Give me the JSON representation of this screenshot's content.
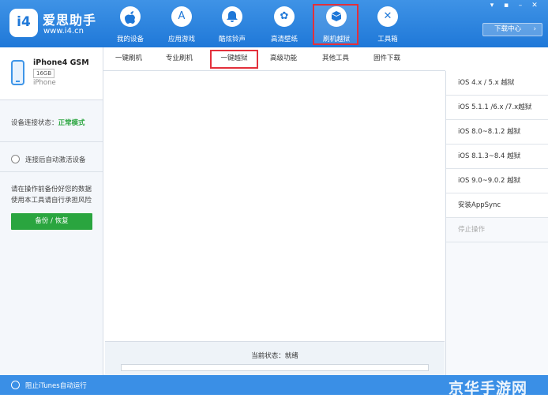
{
  "app": {
    "brand_name": "爱思助手",
    "brand_url": "www.i4.cn",
    "logo_glyph": "i4"
  },
  "nav": [
    {
      "label": "我的设备",
      "icon": "apple-icon",
      "glyph": ""
    },
    {
      "label": "应用游戏",
      "icon": "app-store-icon",
      "glyph": "A"
    },
    {
      "label": "酷炫铃声",
      "icon": "bell-icon",
      "glyph": "♪"
    },
    {
      "label": "高清壁纸",
      "icon": "flower-icon",
      "glyph": "✿"
    },
    {
      "label": "刷机越狱",
      "icon": "box-icon",
      "glyph": "❒",
      "active": true
    },
    {
      "label": "工具箱",
      "icon": "tools-icon",
      "glyph": "✕"
    }
  ],
  "window_controls": [
    "▾",
    "▪",
    "–",
    "✕"
  ],
  "download_center": "下载中心",
  "device": {
    "name": "iPhone4 GSM",
    "capacity": "16GB",
    "type": "iPhone"
  },
  "connection": {
    "label": "设备连接状态：",
    "mode": "正常模式"
  },
  "auto_activate_label": "连接后自动激活设备",
  "warning_lines": [
    "请在操作前备份好您的数据",
    "使用本工具请自行承担风险"
  ],
  "backup_button": "备份 / 恢复",
  "tabs": [
    {
      "label": "一键刷机"
    },
    {
      "label": "专业刷机"
    },
    {
      "label": "一键越狱",
      "active": true
    },
    {
      "label": "高级功能"
    },
    {
      "label": "其他工具"
    },
    {
      "label": "固件下载"
    }
  ],
  "status": {
    "text": "当前状态：就绪",
    "progress": 0
  },
  "options": [
    {
      "label": "iOS 4.x / 5.x 越狱"
    },
    {
      "label": "iOS 5.1.1 /6.x /7.x越狱"
    },
    {
      "label": "iOS 8.0~8.1.2 越狱"
    },
    {
      "label": "iOS 8.1.3~8.4 越狱"
    },
    {
      "label": "iOS 9.0~9.0.2 越狱"
    },
    {
      "label": "安装AppSync"
    },
    {
      "label": "停止操作",
      "disabled": true
    }
  ],
  "bottom": {
    "itunes_label": "阻止iTunes自动运行",
    "watermark": "京华手游网"
  },
  "colors": {
    "brand_blue": "#1f78d8",
    "highlight_red": "#e3303b",
    "ok_green": "#2aa53f"
  }
}
